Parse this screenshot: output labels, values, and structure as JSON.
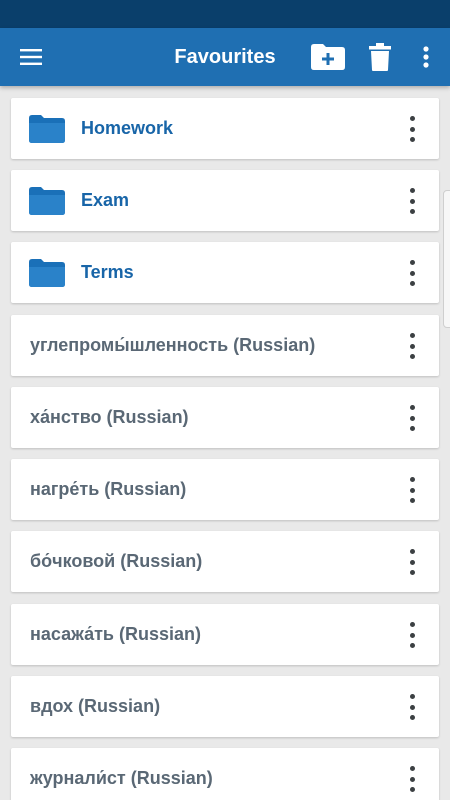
{
  "colors": {
    "status_bar": "#0a3f6b",
    "app_bar": "#1f6fb2",
    "folder": "#1865a8",
    "word_text": "#5a6875",
    "background": "#e9e9e9"
  },
  "app_bar": {
    "title": "Favourites",
    "menu_icon": "hamburger-menu-icon",
    "new_folder_icon": "folder-plus-icon",
    "delete_icon": "trash-icon",
    "overflow_icon": "more-vertical-icon"
  },
  "list": {
    "folders": [
      {
        "label": "Homework",
        "icon": "folder-icon"
      },
      {
        "label": "Exam",
        "icon": "folder-icon"
      },
      {
        "label": "Terms",
        "icon": "folder-icon"
      }
    ],
    "words": [
      {
        "label": "углепромы́шленность (Russian)"
      },
      {
        "label": "ха́нство (Russian)"
      },
      {
        "label": "нагре́ть (Russian)"
      },
      {
        "label": "бо́чковой (Russian)"
      },
      {
        "label": "насажа́ть (Russian)"
      },
      {
        "label": "вдох (Russian)"
      },
      {
        "label": "журнали́ст (Russian)"
      }
    ]
  }
}
